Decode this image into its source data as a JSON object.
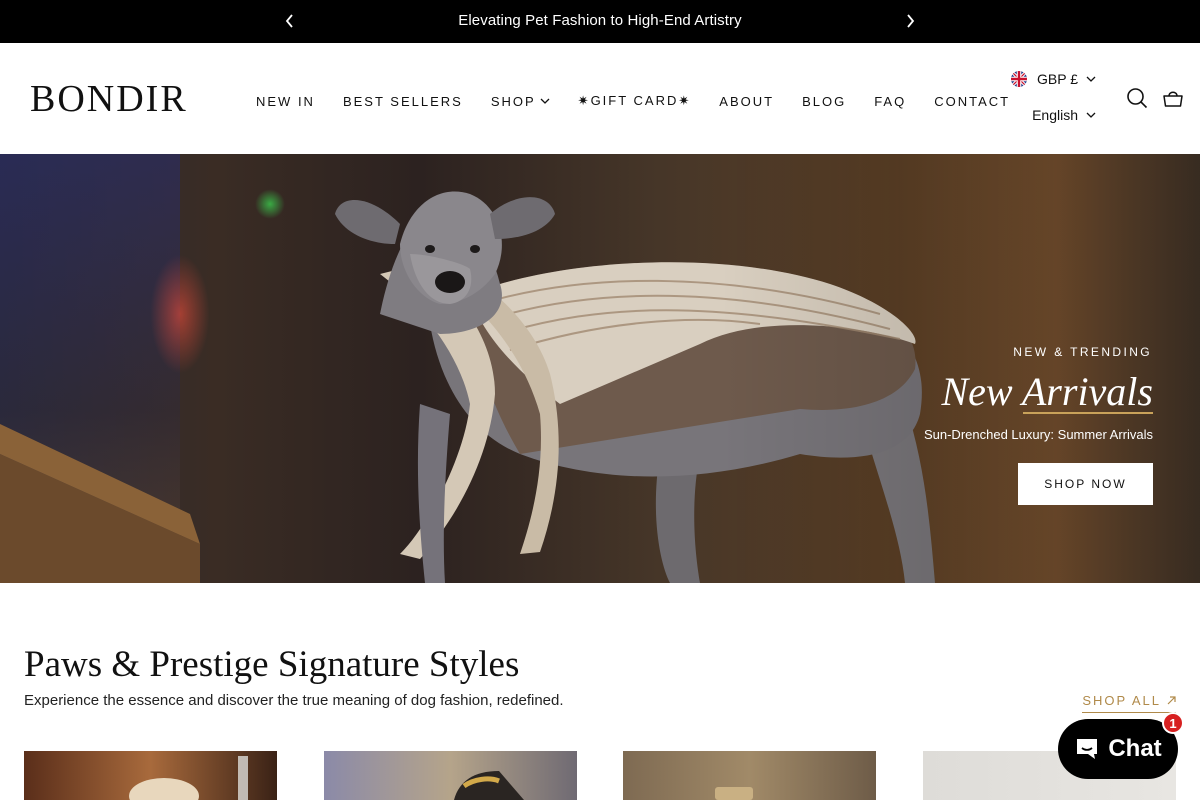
{
  "announcement": {
    "text": "Elevating Pet Fashion to High-End Artistry"
  },
  "header": {
    "logo": "BONDIR",
    "nav": [
      {
        "label": "NEW IN"
      },
      {
        "label": "BEST SELLERS"
      },
      {
        "label": "SHOP"
      },
      {
        "label": "✷GIFT CARD✷"
      },
      {
        "label": "ABOUT"
      },
      {
        "label": "BLOG"
      },
      {
        "label": "FAQ"
      },
      {
        "label": "CONTACT"
      }
    ],
    "currency": "GBP £",
    "language": "English"
  },
  "hero": {
    "eyebrow": "NEW & TRENDING",
    "title": "New Arrivals",
    "subtitle": "Sun-Drenched Luxury: Summer Arrivals",
    "cta": "SHOP NOW"
  },
  "section": {
    "title": "Paws & Prestige Signature Styles",
    "subtitle": "Experience the essence and discover the true meaning of dog fashion, redefined.",
    "shop_all": "SHOP ALL"
  },
  "chat": {
    "label": "Chat",
    "badge": "1"
  },
  "colors": {
    "accent_gold": "#b08a4a",
    "announcement_bg": "#000000",
    "chat_badge": "#d72020"
  },
  "icons": [
    "chevron-left-icon",
    "chevron-right-icon",
    "uk-flag-icon",
    "chevron-down-icon",
    "search-icon",
    "cart-icon",
    "arrow-up-right-icon",
    "chat-bubble-icon"
  ]
}
